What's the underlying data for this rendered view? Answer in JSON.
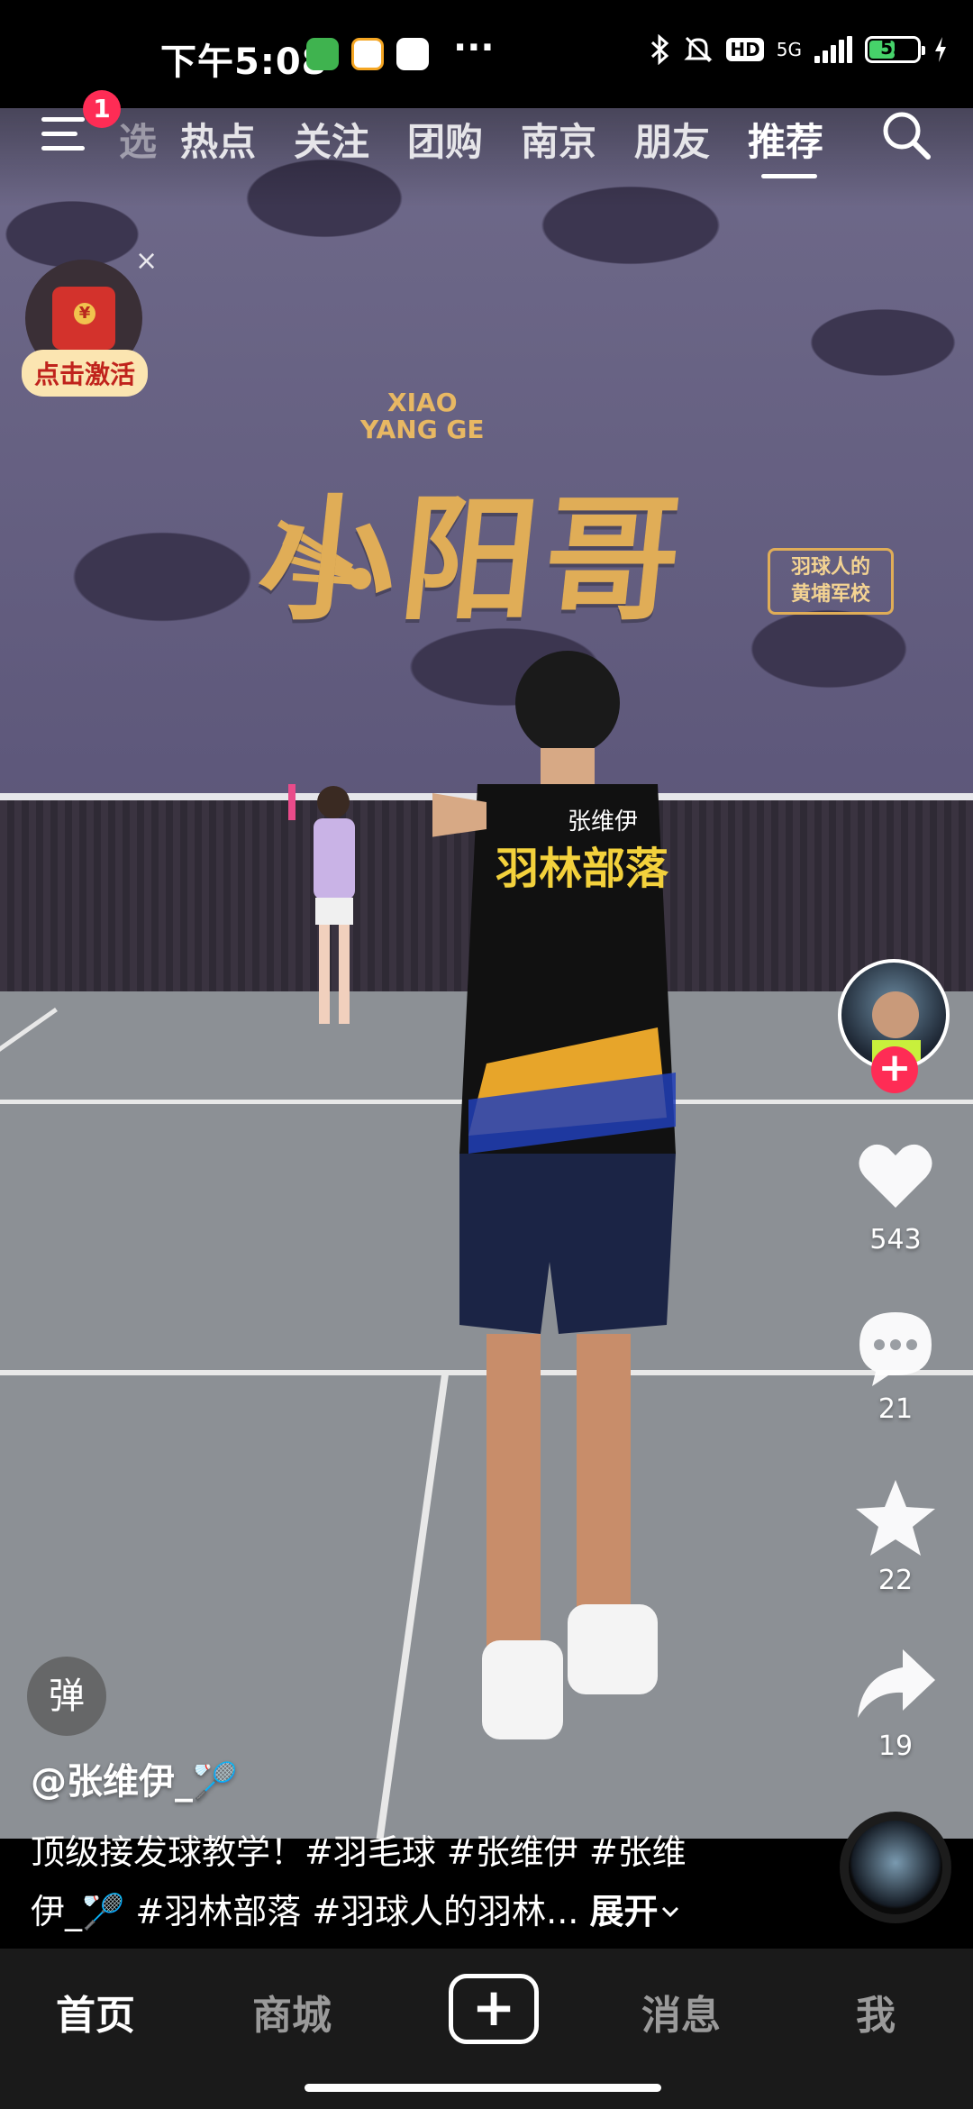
{
  "status_bar": {
    "time": "下午5:08",
    "network": "5G",
    "hd": "HD",
    "battery": "53",
    "battery_level": 0.53,
    "more": "···"
  },
  "top_tabs": {
    "menu_badge": "1",
    "partial_tab": "选",
    "tabs": [
      "热点",
      "关注",
      "团购",
      "南京",
      "朋友",
      "推荐"
    ],
    "active_tab": "推荐"
  },
  "video": {
    "logo_text": "小阳哥",
    "logo_sub_top": "XIAO",
    "logo_sub_bottom": "YANG GE",
    "logo_badge_line1": "羽球人的",
    "logo_badge_line2": "黄埔军校",
    "jersey_name": "张维伊",
    "jersey_team": "羽林部落"
  },
  "promo": {
    "close": "×",
    "label": "点击激活"
  },
  "actions": {
    "follow": "+",
    "likes": "543",
    "comments": "21",
    "favorites": "22",
    "shares": "19"
  },
  "caption": {
    "danmu": "弹",
    "author": "@张维伊_🏸",
    "line1": "顶级接发球教学！#羽毛球 #张维伊 #张维",
    "line2": "伊_🏸 #羽林部落 #羽球人的羽林...",
    "expand": "展开"
  },
  "bottom_nav": {
    "home": "首页",
    "mall": "商城",
    "create": "+",
    "messages": "消息",
    "me": "我"
  },
  "colors": {
    "accent": "#fe2c55",
    "battery_fill": "#46d26a",
    "logo_gold": "#e0ad57"
  }
}
